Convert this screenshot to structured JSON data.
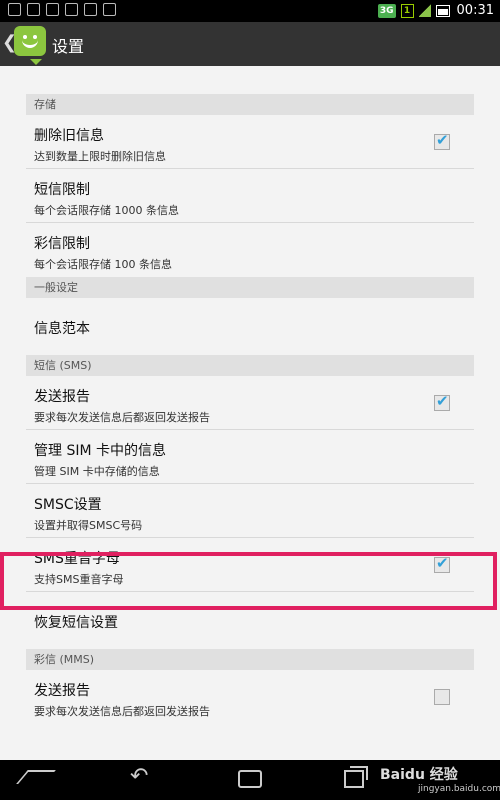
{
  "status_bar": {
    "time": "00:31",
    "network": "3G",
    "sim": "1"
  },
  "action_bar": {
    "title": "设置"
  },
  "list": [
    {
      "type": "category",
      "label": "存储"
    },
    {
      "type": "item",
      "title": "删除旧信息",
      "summary": "达到数量上限时删除旧信息",
      "checkbox": true,
      "checked": true
    },
    {
      "type": "item",
      "title": "短信限制",
      "summary": "每个会话限存储 1000 条信息"
    },
    {
      "type": "item",
      "title": "彩信限制",
      "summary": "每个会话限存储 100 条信息"
    },
    {
      "type": "category",
      "label": "一般设定"
    },
    {
      "type": "item",
      "title": "信息范本"
    },
    {
      "type": "category",
      "label": "短信 (SMS)"
    },
    {
      "type": "item",
      "title": "发送报告",
      "summary": "要求每次发送信息后都返回发送报告",
      "checkbox": true,
      "checked": true
    },
    {
      "type": "item",
      "title": "管理 SIM 卡中的信息",
      "summary": "管理 SIM 卡中存储的信息"
    },
    {
      "type": "item",
      "title": "SMSC设置",
      "summary": "设置并取得SMSC号码",
      "highlighted": true
    },
    {
      "type": "item",
      "title": "SMS重音字母",
      "summary": "支持SMS重音字母",
      "checkbox": true,
      "checked": true
    },
    {
      "type": "item",
      "title": "恢复短信设置"
    },
    {
      "type": "category",
      "label": "彩信 (MMS)"
    },
    {
      "type": "item",
      "title": "发送报告",
      "summary": "要求每次发送信息后都返回发送报告",
      "checkbox": true,
      "checked": false
    }
  ],
  "colors": {
    "highlight_border": "#e02060",
    "check_blue": "#33a0d8",
    "app_icon_green": "#8cc63f"
  },
  "watermark": {
    "text": "Baidu 经验",
    "url": "jingyan.baidu.com"
  },
  "icons": [
    "back-chevron-icon",
    "messaging-app-icon",
    "home-icon",
    "back-icon",
    "camera-icon",
    "recent-apps-icon"
  ]
}
